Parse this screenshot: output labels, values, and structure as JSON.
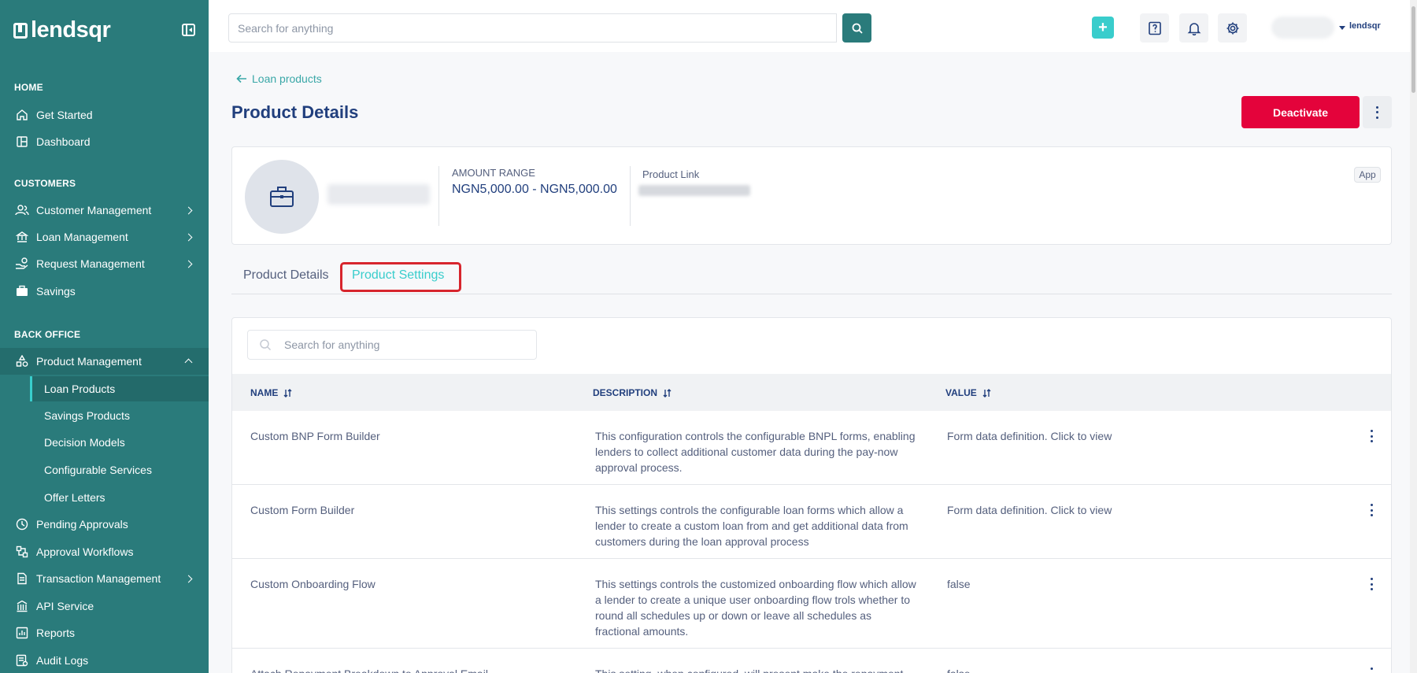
{
  "brand": {
    "name": "lendsqr"
  },
  "sidebar": {
    "sections": {
      "home": "HOME",
      "customers": "CUSTOMERS",
      "back_office": "BACK OFFICE"
    },
    "items": {
      "get_started": "Get Started",
      "dashboard": "Dashboard",
      "customer_management": "Customer Management",
      "loan_management": "Loan Management",
      "request_management": "Request Management",
      "savings": "Savings",
      "product_management": "Product Management",
      "pending_approvals": "Pending Approvals",
      "approval_workflows": "Approval Workflows",
      "transaction_management": "Transaction Management",
      "api_service": "API Service",
      "reports": "Reports",
      "audit_logs": "Audit Logs"
    },
    "sub_items": {
      "loan_products": "Loan Products",
      "savings_products": "Savings Products",
      "decision_models": "Decision Models",
      "configurable_services": "Configurable Services",
      "offer_letters": "Offer Letters"
    }
  },
  "topbar": {
    "search_placeholder": "Search for anything",
    "plus": "+",
    "brand_small": "lendsqr"
  },
  "breadcrumb": {
    "back_label": "Loan products"
  },
  "page": {
    "title": "Product Details",
    "deactivate_label": "Deactivate"
  },
  "summary": {
    "amount_label": "AMOUNT RANGE",
    "amount_value": "NGN5,000.00 - NGN5,000.00",
    "link_label": "Product Link",
    "badge": "App"
  },
  "tabs": [
    "Product Details",
    "Product Settings"
  ],
  "table": {
    "search_placeholder": "Search for anything",
    "headers": [
      "NAME",
      "DESCRIPTION",
      "VALUE"
    ],
    "rows": [
      {
        "name": "Custom BNP Form Builder",
        "description": "This configuration controls the configurable BNPL forms, enabling lenders to collect additional customer data during the pay-now approval process.",
        "value": "Form data definition. Click to view"
      },
      {
        "name": "Custom Form Builder",
        "description": "This settings controls the configurable loan forms which allow a lender to create a custom loan from and get additional data from customers during the loan approval process",
        "value": "Form data definition. Click to view"
      },
      {
        "name": "Custom Onboarding Flow",
        "description": "This settings controls the customized onboarding flow which allow a lender to create a unique user onboarding flow trols whether to round all schedules up or down or leave all schedules as fractional amounts.",
        "value": "false"
      },
      {
        "name": "Attach Repayment Breakdown to Approval Email",
        "description": "This setting, when configured, will present make the repayment",
        "value": "false"
      }
    ]
  }
}
